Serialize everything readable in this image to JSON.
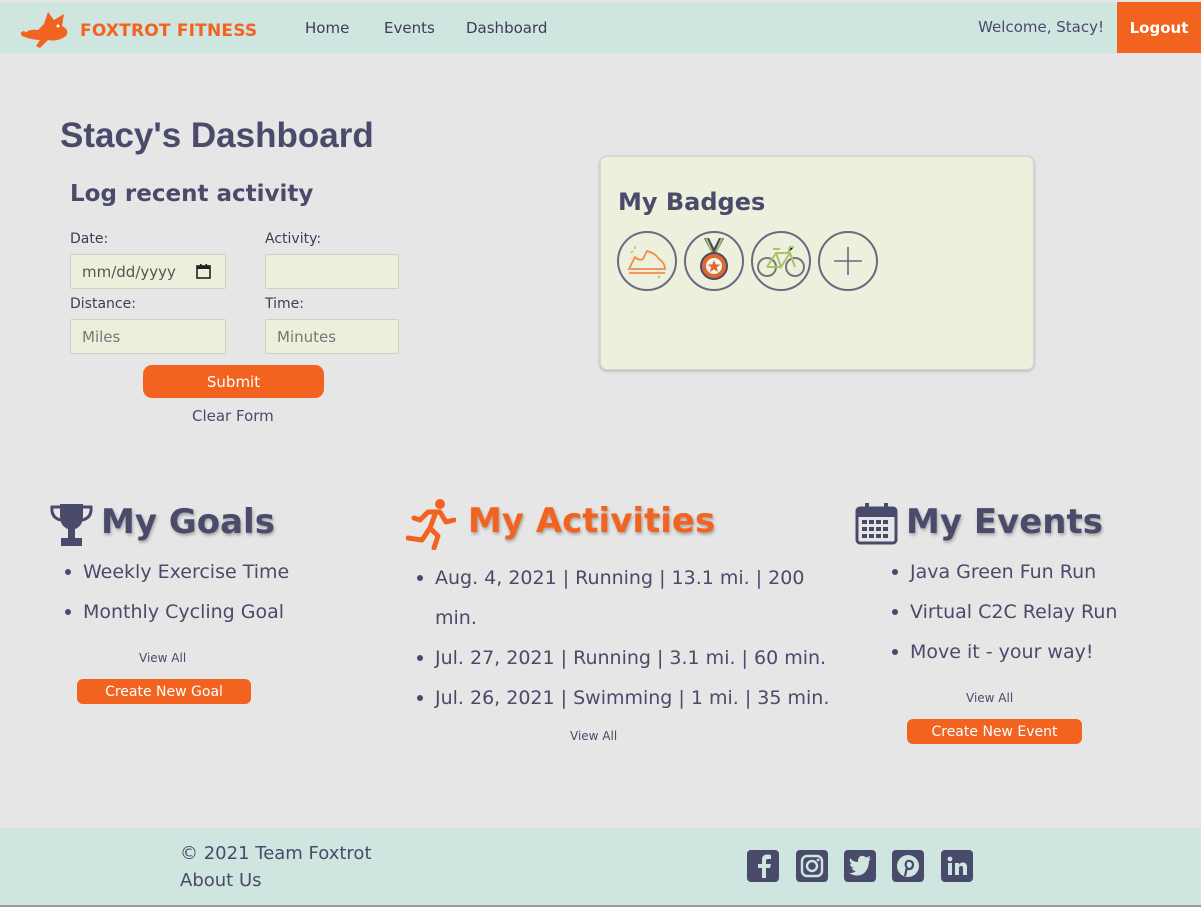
{
  "nav": {
    "brand": "FOXTROT FITNESS",
    "links": [
      "Home",
      "Events",
      "Dashboard"
    ],
    "welcome": "Welcome, Stacy!",
    "logout": "Logout"
  },
  "dashboard": {
    "title": "Stacy's Dashboard",
    "log": {
      "title": "Log recent activity",
      "date_label": "Date:",
      "date_placeholder": "mm/dd/yyyy",
      "activity_label": "Activity:",
      "activity_value": "",
      "distance_label": "Distance:",
      "distance_placeholder": "Miles",
      "time_label": "Time:",
      "time_placeholder": "Minutes",
      "submit": "Submit",
      "clear": "Clear Form"
    },
    "badges": {
      "title": "My Badges",
      "items": [
        "running-shoe",
        "medal",
        "bicycle",
        "add"
      ]
    }
  },
  "goals": {
    "title": "My Goals",
    "items": [
      "Weekly Exercise Time",
      "Monthly Cycling Goal"
    ],
    "view_all": "View All",
    "create": "Create New Goal"
  },
  "activities": {
    "title": "My Activities",
    "items": [
      "Aug. 4, 2021 | Running | 13.1 mi. | 200 min.",
      "Jul. 27, 2021 | Running | 3.1 mi. | 60 min.",
      "Jul. 26, 2021 | Swimming | 1 mi. | 35 min."
    ],
    "view_all": "View All"
  },
  "events": {
    "title": "My Events",
    "items": [
      "Java Green Fun Run",
      "Virtual C2C Relay Run",
      "Move it - your way!"
    ],
    "view_all": "View All",
    "create": "Create New Event"
  },
  "footer": {
    "copyright": "© 2021 Team Foxtrot",
    "about": "About Us",
    "social": [
      "facebook",
      "instagram",
      "twitter",
      "pinterest",
      "linkedin"
    ]
  },
  "colors": {
    "accent": "#f2631f",
    "nav_bg": "#cfe5e0",
    "page_bg": "#e6e6e6",
    "text": "#4a4a6a",
    "card_bg": "#ecf0dc"
  }
}
